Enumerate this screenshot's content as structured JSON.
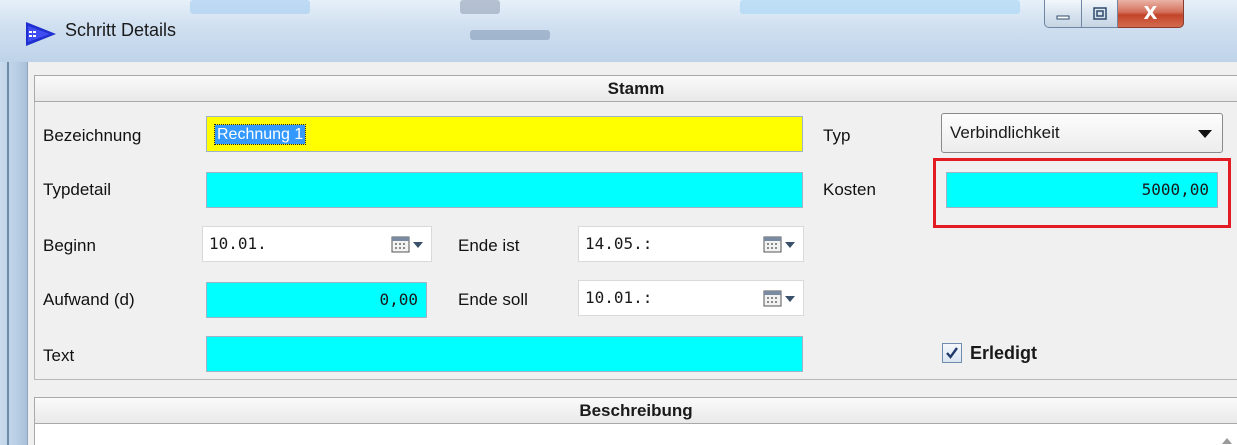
{
  "window": {
    "title": "Schritt Details",
    "close_glyph": "X"
  },
  "stamm": {
    "header": "Stamm",
    "bezeichnung_label": "Bezeichnung",
    "bezeichnung_value": "Rechnung 1",
    "typ_label": "Typ",
    "typ_value": "Verbindlichkeit",
    "typdetail_label": "Typdetail",
    "typdetail_value": "",
    "kosten_label": "Kosten",
    "kosten_value": "5000,00",
    "beginn_label": "Beginn",
    "beginn_value": "10.01.",
    "ende_ist_label": "Ende ist",
    "ende_ist_value": "14.05.:",
    "aufwand_label": "Aufwand (d)",
    "aufwand_value": "0,00",
    "ende_soll_label": "Ende soll",
    "ende_soll_value": "10.01.:",
    "text_label": "Text",
    "text_value": "",
    "erledigt_label": "Erledigt",
    "erledigt_checked": true
  },
  "beschreibung": {
    "header": "Beschreibung",
    "value": ""
  },
  "colors": {
    "required_field": "#00ffff",
    "focused_field": "#ffff00",
    "highlight": "#e31b23"
  },
  "icons": [
    "app-logo-icon",
    "minimize-icon",
    "maximize-icon",
    "close-icon",
    "calendar-icon",
    "dropdown-arrow-icon",
    "checkmark-icon"
  ]
}
